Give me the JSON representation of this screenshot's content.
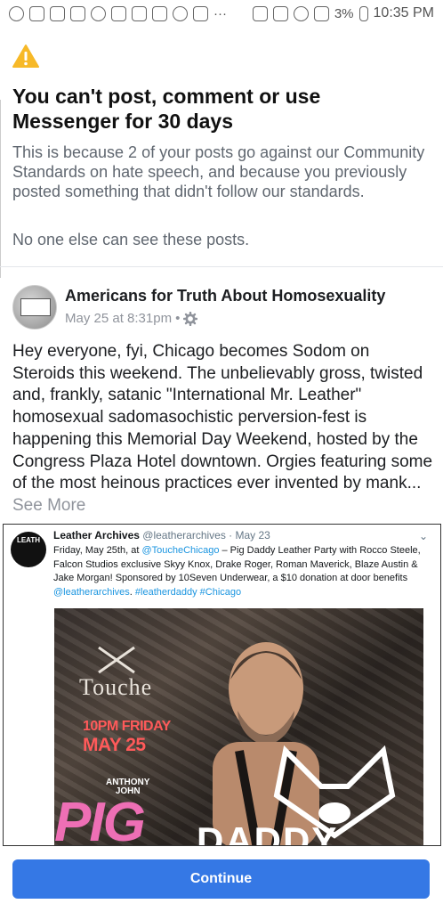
{
  "status_bar": {
    "time": "10:35 PM",
    "battery": "3%"
  },
  "restriction": {
    "headline": "You can't post, comment or use Messenger for 30 days",
    "explanation": "This is because 2 of your posts go against our Community Standards on hate speech, and because you previously posted something that didn't follow our standards.",
    "visibility_note": "No one else can see these posts."
  },
  "post": {
    "page_name": "Americans for Truth About Homosexuality",
    "timestamp": "May 25 at 8:31pm",
    "separator": "•",
    "body": "Hey everyone, fyi, Chicago becomes Sodom on Steroids this weekend. The unbelievably gross, twisted and, frankly, satanic \"International Mr. Leather\" homosexual sadomasochistic perversion-fest is happening this Memorial Day Weekend, hosted by the Congress Plaza Hotel downtown. Orgies featuring some of the most heinous practices ever invented by mank...",
    "see_more": "See More"
  },
  "embedded_tweet": {
    "avatar_text": "LEATH",
    "author": "Leather Archives",
    "handle": "@leatherarchives · May 23",
    "text_1": "Friday, May 25th, at ",
    "mention_1": "@ToucheChicago",
    "text_2": " – Pig Daddy Leather Party with Rocco Steele, Falcon Studios exclusive Skyy Knox, Drake Roger, Roman Maverick, Blaze Austin & Jake Morgan! Sponsored by 10Seven Underwear,  a $10 donation at door benefits ",
    "mention_2": "@leatherarchives",
    "text_3": ". ",
    "hashtags": "#leatherdaddy #Chicago",
    "poster": {
      "venue": "Touche",
      "time": "10PM FRIDAY",
      "date": "MAY 25",
      "dj_line1": "ANTHONY",
      "dj_line2": "JOHN",
      "title_pig": "PIG",
      "title_daddy": "DADDY"
    }
  },
  "footer": {
    "continue_label": "Continue"
  },
  "colors": {
    "primary_button": "#3578e5",
    "warning_icon": "#f7b928",
    "muted_text": "#606770",
    "poster_accent_red": "#ff5a5a",
    "poster_accent_pink": "#ee6fb5"
  }
}
